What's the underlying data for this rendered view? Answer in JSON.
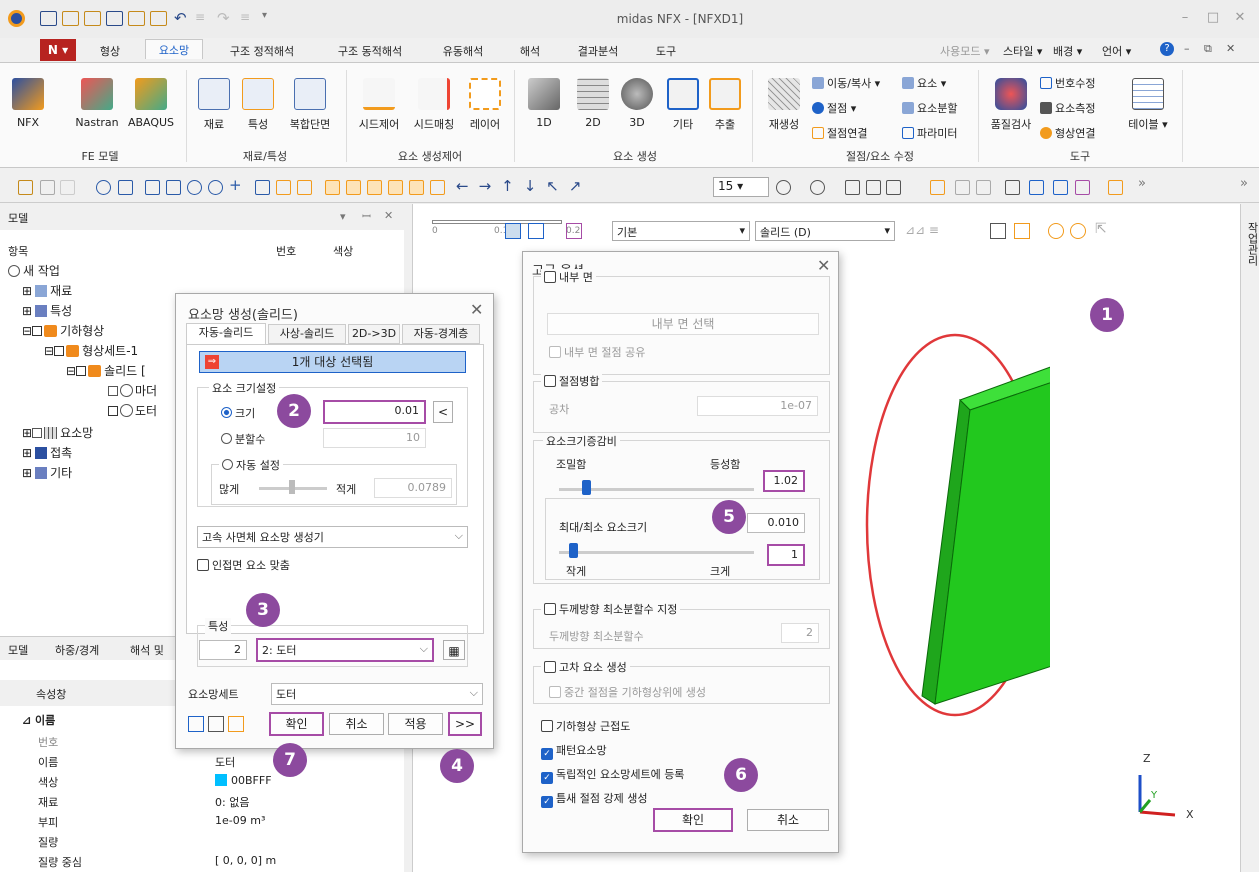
{
  "window": {
    "title": "midas NFX - [NFXD1]"
  },
  "menu": {
    "items": [
      "형상",
      "요소망",
      "구조 정적해석",
      "구조 동적해석",
      "유동해석",
      "해석",
      "결과분석",
      "도구"
    ],
    "right": [
      "사용모드",
      "스타일",
      "배경",
      "언어"
    ]
  },
  "ribbon": {
    "fe_model": {
      "label": "FE 모델",
      "buttons": [
        "NFX",
        "Nastran",
        "ABAQUS"
      ]
    },
    "material": {
      "label": "재료/특성",
      "buttons": [
        "재료",
        "특성",
        "복합단면"
      ]
    },
    "seed": {
      "label": "요소 생성제어",
      "buttons": [
        "시드제어",
        "시드매칭",
        "레이어"
      ]
    },
    "elements": {
      "label": "요소 생성",
      "buttons": [
        "1D",
        "2D",
        "3D",
        "기타",
        "추출"
      ]
    },
    "edit": {
      "label": "절점/요소 수정",
      "regen": "재생성",
      "small": [
        "이동/복사",
        "요소",
        "절점",
        "요소분할",
        "절점연결",
        "파라미터"
      ]
    },
    "tools": {
      "label": "도구",
      "buttons": [
        "품질검사",
        "테이블"
      ],
      "small": [
        "번호수정",
        "요소측정",
        "형상연결"
      ]
    }
  },
  "toolbar": {
    "zoom_value": "15"
  },
  "left_panel": {
    "title": "모델",
    "col_item": "항목",
    "col_num": "번호",
    "col_color": "색상",
    "tree": [
      "새 작업",
      "재료",
      "특성",
      "기하형상",
      "형상세트-1",
      "솔리드 [",
      "마더",
      "도터",
      "요소망",
      "접촉",
      "기타"
    ],
    "bottom_tabs": [
      "모델",
      "하중/경계",
      "해석 및"
    ]
  },
  "properties": {
    "title": "속성창",
    "section": "이름",
    "rows": [
      {
        "k": "번호",
        "v": ""
      },
      {
        "k": "이름",
        "v": "도터"
      },
      {
        "k": "색상",
        "v": "00BFFF"
      },
      {
        "k": "재료",
        "v": "0: 없음"
      },
      {
        "k": "부피",
        "v": "1e-09 m³"
      },
      {
        "k": "질량",
        "v": ""
      },
      {
        "k": "질량 중심",
        "v": "[ 0,    0,    0] m"
      }
    ],
    "swatch": "#00bfff"
  },
  "mesh_dialog": {
    "title": "요소망 생성(솔리드)",
    "tabs": [
      "자동-솔리드",
      "사상-솔리드",
      "2D->3D",
      "자동-경계층"
    ],
    "target": "1개 대상 선택됨",
    "size_group": "요소 크기설정",
    "size_label": "크기",
    "size_value": "0.01",
    "div_label": "분할수",
    "div_value": "10",
    "auto_label": "자동 설정",
    "many": "많게",
    "few": "적게",
    "auto_value": "0.0789",
    "mesher": "고속 사면체 요소망 생성기",
    "adjacent": "인접면 요소 맞춤",
    "prop_group": "특성",
    "prop_num": "2",
    "prop_value": "2: 도터",
    "meshset_label": "요소망세트",
    "meshset_value": "도터",
    "ok": "확인",
    "cancel": "취소",
    "apply": "적용",
    "more": ">>"
  },
  "adv_dialog": {
    "title": "고급 옵션",
    "inner_face": "내부 면",
    "inner_select": "내부 면 선택",
    "inner_share": "내부 면 절점 공유",
    "merge": "절점병합",
    "tol": "공차",
    "tol_value": "1e-07",
    "grading": "요소크기증감비",
    "fine": "조밀함",
    "uniform": "등성함",
    "grading_value": "1.02",
    "maxmin": "최대/최소 요소크기",
    "maxmin_value": "0.010",
    "ratio_value": "1",
    "small": "작게",
    "large": "크게",
    "thick": "두께방향 최소분할수 지정",
    "thick_label": "두께방향 최소분할수",
    "thick_value": "2",
    "high": "고차 요소 생성",
    "mid": "중간 절점을 기하형상위에 생성",
    "proximity": "기하형상 근접도",
    "pattern": "패턴요소망",
    "register": "독립적인 요소망세트에 등록",
    "gap": "틈새 절점 강제 생성",
    "ok": "확인",
    "cancel": "취소"
  },
  "viewport": {
    "view_combo": "기본",
    "render_combo": "솔리드 (D)",
    "ruler": [
      "0",
      "0.1",
      "0.2"
    ],
    "side_tab": "작업관리",
    "axes": {
      "x": "X",
      "y": "Y",
      "z": "Z"
    }
  },
  "badges": [
    "1",
    "2",
    "3",
    "4",
    "5",
    "6",
    "7"
  ],
  "colors": {
    "accent": "#8c4a9e",
    "highlight": "#a64ca6",
    "box": "#22c81e",
    "select_blue": "#1e62c8",
    "ellipse": "#e0383a"
  }
}
